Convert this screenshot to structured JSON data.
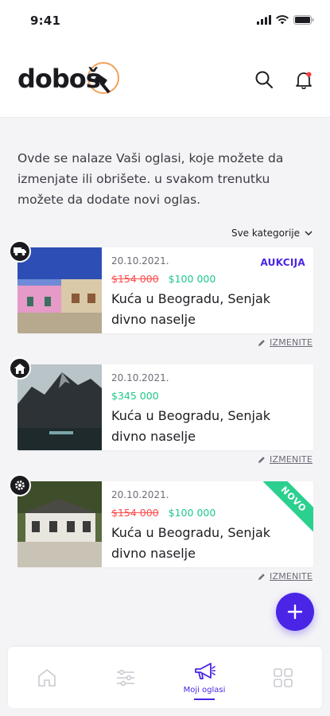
{
  "status_bar": {
    "time": "9:41"
  },
  "header": {
    "logo_text": "doboš"
  },
  "intro": {
    "text": "Ovde se nalaze Vaši oglasi, koje možete da izmenjate ili obrišete. u svakom trenutku možete da dodate novi oglas."
  },
  "filter": {
    "label": "Sve kategorije"
  },
  "listings": [
    {
      "category_icon": "truck-icon",
      "date": "20.10.2021.",
      "old_price": "$154 000",
      "new_price": "$100 000",
      "title": "Kuća u Beogradu, Senjak divno naselje",
      "tag": "AUKCIJA",
      "edit_label": "IZMENITE"
    },
    {
      "category_icon": "home-icon",
      "date": "20.10.2021.",
      "old_price": "",
      "new_price": "$345 000",
      "title": "Kuća u Beogradu, Senjak divno naselje",
      "tag": "",
      "edit_label": "IZMENITE"
    },
    {
      "category_icon": "gear-icon",
      "date": "20.10.2021.",
      "old_price": "$154 000",
      "new_price": "$100 000",
      "title": "Kuća u Beogradu, Senjak divno naselje",
      "tag": "NOVO",
      "edit_label": "IZMENITE"
    }
  ],
  "bottom_nav": {
    "items": [
      {
        "icon": "home-icon",
        "label": ""
      },
      {
        "icon": "sliders-icon",
        "label": ""
      },
      {
        "icon": "megaphone-icon",
        "label": "Moji oglasi"
      },
      {
        "icon": "grid-icon",
        "label": ""
      }
    ]
  },
  "colors": {
    "accent": "#4b25e6",
    "price_new": "#1fc88a",
    "price_old": "#ff4d4d",
    "ribbon": "#2bd08f"
  }
}
